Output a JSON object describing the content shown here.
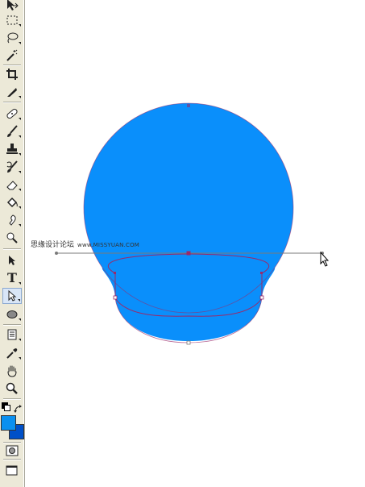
{
  "toolbar": {
    "tools": [
      {
        "name": "move-tool",
        "icon": "move-icon"
      },
      {
        "name": "marquee-tool",
        "icon": "marquee-icon"
      },
      {
        "name": "lasso-tool",
        "icon": "lasso-icon"
      },
      {
        "name": "magic-wand-tool",
        "icon": "magic-wand-icon"
      },
      {
        "name": "crop-tool",
        "icon": "crop-icon"
      },
      {
        "name": "slice-tool",
        "icon": "slice-icon"
      },
      {
        "name": "healing-brush-tool",
        "icon": "bandage-icon"
      },
      {
        "name": "brush-tool",
        "icon": "brush-icon"
      },
      {
        "name": "clone-stamp-tool",
        "icon": "stamp-icon"
      },
      {
        "name": "history-brush-tool",
        "icon": "history-brush-icon"
      },
      {
        "name": "eraser-tool",
        "icon": "eraser-icon"
      },
      {
        "name": "paint-bucket-tool",
        "icon": "bucket-icon"
      },
      {
        "name": "smudge-tool",
        "icon": "smudge-icon"
      },
      {
        "name": "dodge-tool",
        "icon": "dodge-icon"
      },
      {
        "name": "path-selection-tool",
        "icon": "arrow-icon"
      },
      {
        "name": "type-tool",
        "icon": "type-icon"
      },
      {
        "name": "direct-selection-tool",
        "icon": "direct-selection-icon",
        "active": true
      },
      {
        "name": "ellipse-tool",
        "icon": "ellipse-icon"
      },
      {
        "name": "notes-tool",
        "icon": "notes-icon"
      },
      {
        "name": "eyedropper-tool",
        "icon": "eyedropper-icon"
      },
      {
        "name": "hand-tool",
        "icon": "hand-icon"
      },
      {
        "name": "zoom-tool",
        "icon": "zoom-icon"
      }
    ],
    "type_tool_glyph": "T",
    "foreground_color": "#0a90f0",
    "background_color": "#0050c8"
  },
  "canvas": {
    "shape_fill": "#0a8ffb",
    "path_stroke": "#9a2a6a",
    "handle_line": "#7a7a7a"
  },
  "watermark": {
    "main": "思缘设计论坛",
    "sub": "www.MISSYUAN.COM"
  }
}
